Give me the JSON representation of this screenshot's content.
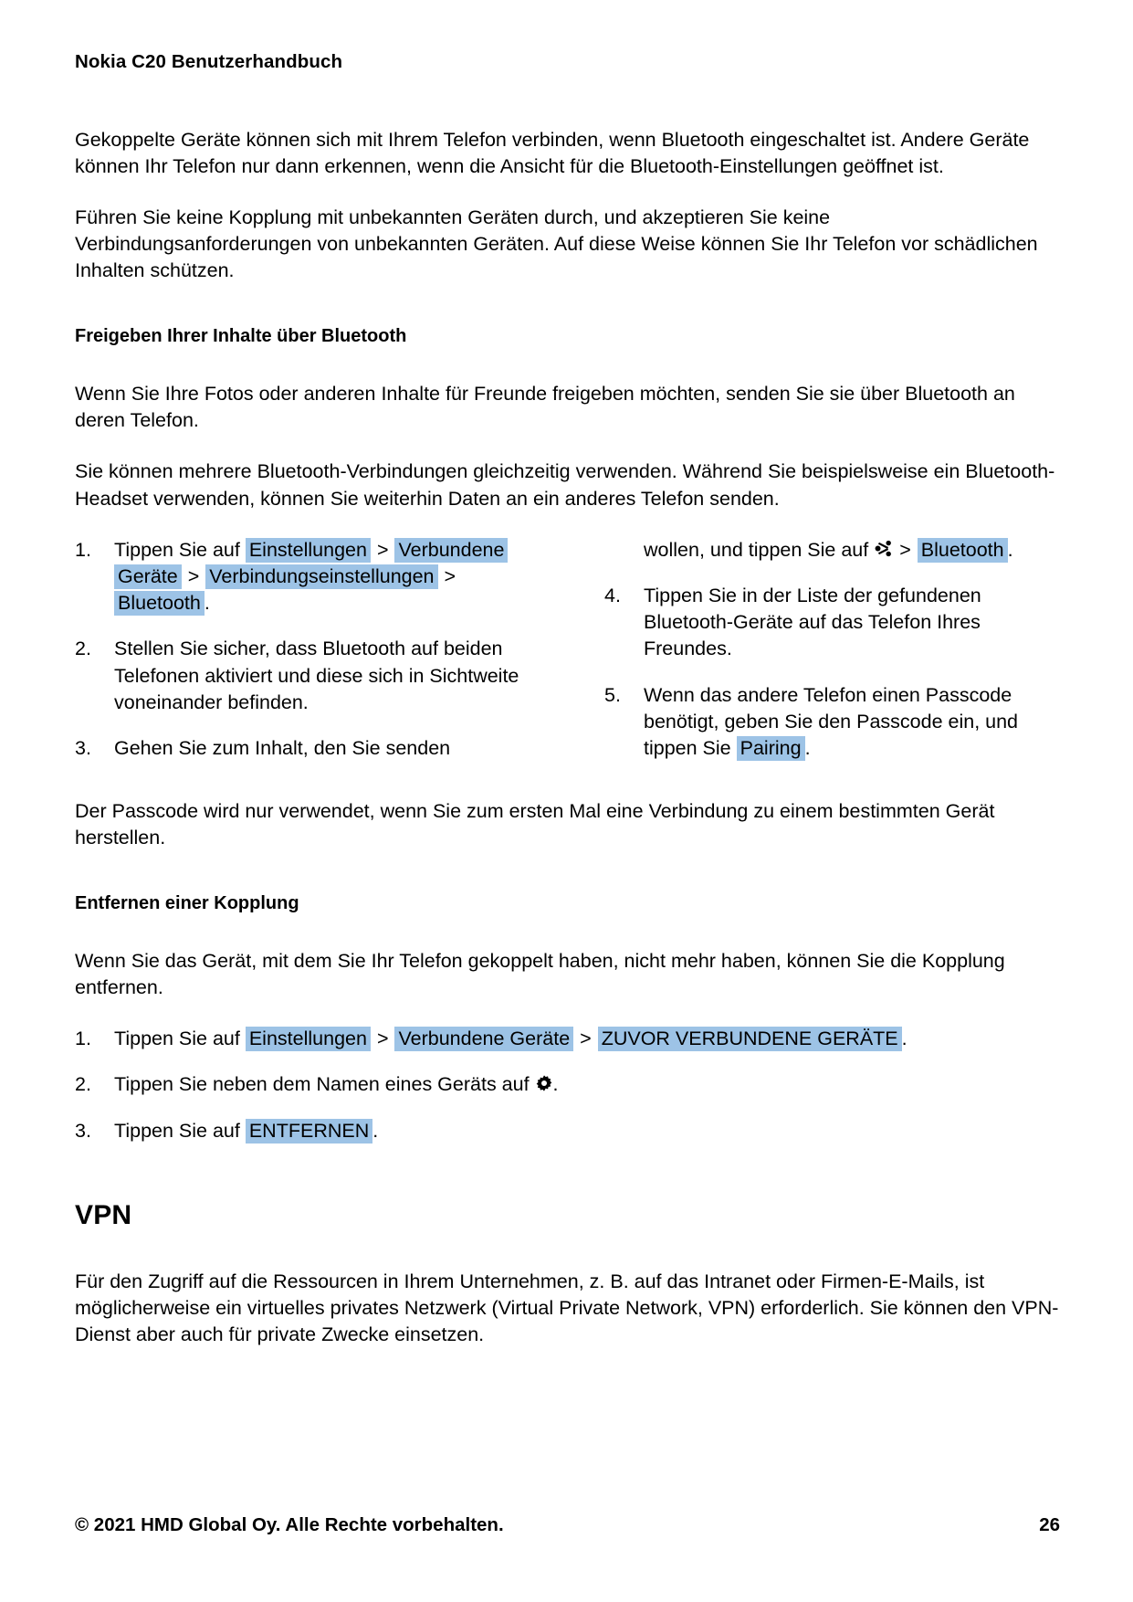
{
  "header": {
    "title": "Nokia C20 Benutzerhandbuch"
  },
  "intro": {
    "p1": "Gekoppelte Geräte können sich mit Ihrem Telefon verbinden, wenn Bluetooth eingeschaltet ist. Andere Geräte können Ihr Telefon nur dann erkennen, wenn die Ansicht für die Bluetooth-Einstellungen geöffnet ist.",
    "p2": "Führen Sie keine Kopplung mit unbekannten Geräten durch, und akzeptieren Sie keine Verbindungsanforderungen von unbekannten Geräten. Auf diese Weise können Sie Ihr Telefon vor schädlichen Inhalten schützen."
  },
  "share_section": {
    "heading": "Freigeben Ihrer Inhalte über Bluetooth",
    "p1": "Wenn Sie Ihre Fotos oder anderen Inhalte für Freunde freigeben möchten, senden Sie sie über Bluetooth an deren Telefon.",
    "p2": "Sie können mehrere Bluetooth-Verbindungen gleichzeitig verwenden. Während Sie beispielsweise ein Bluetooth-Headset verwenden, können Sie weiterhin Daten an ein anderes Telefon senden.",
    "steps": {
      "s1": {
        "num": "1.",
        "lead": "Tippen Sie auf",
        "chip1": "Einstellungen",
        "sep1": ">",
        "chip2": "Verbundene Geräte",
        "sep2": ">",
        "chip3": "Verbindungseinstellungen",
        "sep3": ">",
        "chip4": "Bluetooth",
        "end": "."
      },
      "s2": {
        "num": "2.",
        "text": "Stellen Sie sicher, dass Bluetooth auf beiden Telefonen aktiviert und diese sich in Sichtweite voneinander befinden."
      },
      "s3": {
        "num": "3.",
        "text_start": "Gehen Sie zum Inhalt, den Sie senden",
        "text_cont": "wollen, und tippen Sie auf",
        "icon": "share-icon",
        "sep1": ">",
        "chip1": "Bluetooth",
        "end": "."
      },
      "s4": {
        "num": "4.",
        "text": "Tippen Sie in der Liste der gefundenen Bluetooth-Geräte auf das Telefon Ihres Freundes."
      },
      "s5": {
        "num": "5.",
        "lead": "Wenn das andere Telefon einen Passcode benötigt, geben Sie den Passcode ein, und tippen Sie",
        "chip1": "Pairing",
        "end": "."
      }
    },
    "note": "Der Passcode wird nur verwendet, wenn Sie zum ersten Mal eine Verbindung zu einem bestimmten Gerät herstellen."
  },
  "unpair_section": {
    "heading": "Entfernen einer Kopplung",
    "p1": "Wenn Sie das Gerät, mit dem Sie Ihr Telefon gekoppelt haben, nicht mehr haben, können Sie die Kopplung entfernen.",
    "steps": {
      "s1": {
        "num": "1.",
        "lead": "Tippen Sie auf",
        "chip1": "Einstellungen",
        "sep1": ">",
        "chip2": "Verbundene Geräte",
        "sep2": ">",
        "chip3": "ZUVOR VERBUNDENE GERÄTE",
        "end": "."
      },
      "s2": {
        "num": "2.",
        "lead": "Tippen Sie neben dem Namen eines Geräts auf",
        "icon": "gear-icon",
        "end": "."
      },
      "s3": {
        "num": "3.",
        "lead": "Tippen Sie auf",
        "chip1": "ENTFERNEN",
        "end": "."
      }
    }
  },
  "vpn_section": {
    "heading": "VPN",
    "p1": "Für den Zugriff auf die Ressourcen in Ihrem Unternehmen, z. B. auf das Intranet oder Firmen-E-Mails, ist möglicherweise ein virtuelles privates Netzwerk (Virtual Private Network, VPN) erforderlich. Sie können den VPN-Dienst aber auch für private Zwecke einsetzen."
  },
  "footer": {
    "copyright": "© 2021 HMD Global Oy. Alle Rechte vorbehalten.",
    "page_number": "26"
  },
  "colors": {
    "highlight": "#9dc3e6",
    "text": "#000000",
    "background": "#ffffff"
  }
}
